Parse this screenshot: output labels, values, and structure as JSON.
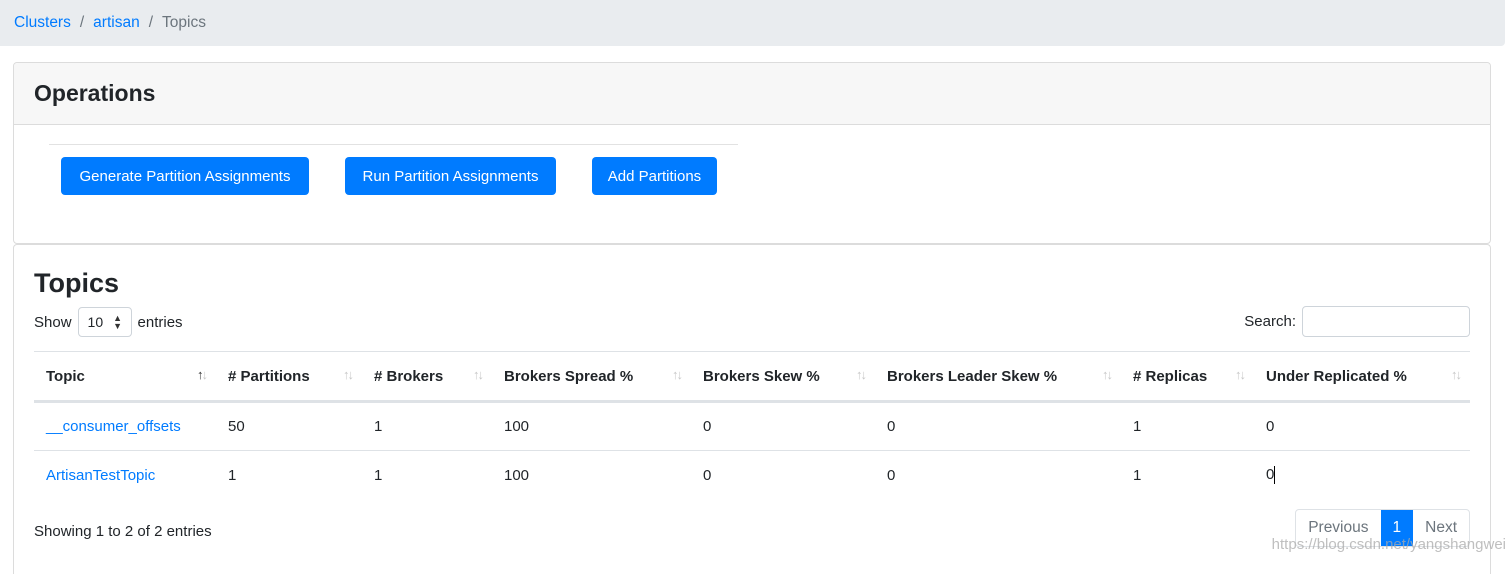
{
  "breadcrumb": {
    "items": [
      {
        "label": "Clusters",
        "link": true
      },
      {
        "label": "artisan",
        "link": true
      },
      {
        "label": "Topics",
        "link": false
      }
    ],
    "separator": "/"
  },
  "operations": {
    "title": "Operations",
    "buttons": {
      "generate": "Generate Partition Assignments",
      "run": "Run Partition Assignments",
      "add": "Add Partitions"
    }
  },
  "topics": {
    "title": "Topics",
    "length": {
      "show_label": "Show",
      "value": "10",
      "entries_label": "entries"
    },
    "search": {
      "label": "Search:",
      "value": ""
    },
    "columns": [
      {
        "label": "Topic",
        "sort": "asc"
      },
      {
        "label": "# Partitions",
        "sort": "none"
      },
      {
        "label": "# Brokers",
        "sort": "none"
      },
      {
        "label": "Brokers Spread %",
        "sort": "none"
      },
      {
        "label": "Brokers Skew %",
        "sort": "none"
      },
      {
        "label": "Brokers Leader Skew %",
        "sort": "none"
      },
      {
        "label": "# Replicas",
        "sort": "none"
      },
      {
        "label": "Under Replicated %",
        "sort": "none"
      }
    ],
    "rows": [
      {
        "topic": "__consumer_offsets",
        "partitions": "50",
        "brokers": "1",
        "spread": "100",
        "skew": "0",
        "leader_skew": "0",
        "replicas": "1",
        "under_replicated": "0"
      },
      {
        "topic": "ArtisanTestTopic",
        "partitions": "1",
        "brokers": "1",
        "spread": "100",
        "skew": "0",
        "leader_skew": "0",
        "replicas": "1",
        "under_replicated": "0"
      }
    ],
    "info": "Showing 1 to 2 of 2 entries",
    "pagination": {
      "previous": "Previous",
      "current": "1",
      "next": "Next"
    }
  },
  "sort_icons": {
    "up": "↑",
    "down": "↓"
  },
  "colors": {
    "primary": "#007bff",
    "breadcrumb_bg": "#e9ecef",
    "muted": "#6c757d"
  },
  "watermark": "https://blog.csdn.net/yangshangwei"
}
